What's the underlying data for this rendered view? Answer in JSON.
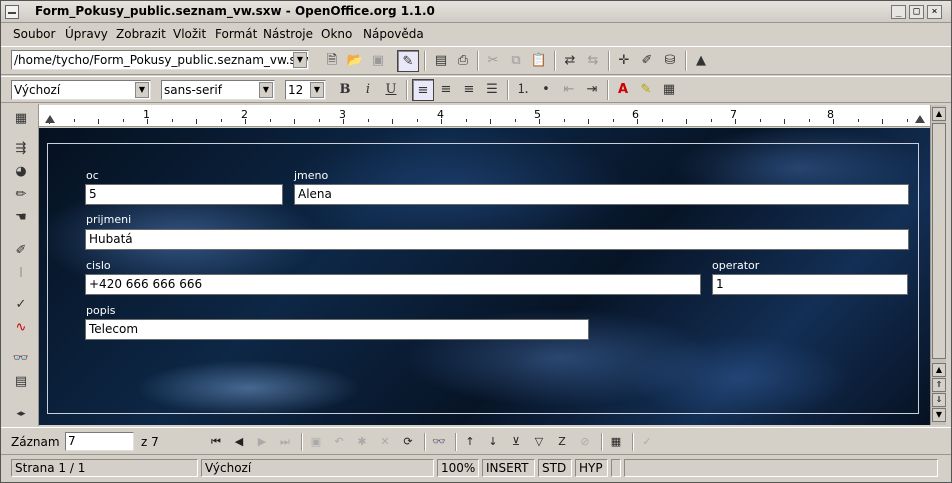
{
  "window": {
    "title": "Form_Pokusy_public.seznam_vw.sxw - OpenOffice.org 1.1.0"
  },
  "menu": [
    "Soubor",
    "Úpravy",
    "Zobrazit",
    "Vložit",
    "Formát",
    "Nástroje",
    "Okno",
    "Nápověda"
  ],
  "toolbar": {
    "url_value": "/home/tycho/Form_Pokusy_public.seznam_vw.sxw",
    "style_value": "Výchozí",
    "font_value": "sans-serif",
    "size_value": "12",
    "bold": "B",
    "italic": "i",
    "underline": "U"
  },
  "ruler": {
    "numbers": [
      "1",
      "2",
      "3",
      "4",
      "5",
      "6",
      "7",
      "8"
    ]
  },
  "form": {
    "oc": {
      "label": "oc",
      "value": "5"
    },
    "jmeno": {
      "label": "jmeno",
      "value": "Alena"
    },
    "prijmeni": {
      "label": "prijmeni",
      "value": "Hubatá"
    },
    "cislo": {
      "label": "cislo",
      "value": "+420 666 666 666"
    },
    "operator": {
      "label": "operator",
      "value": "1"
    },
    "popis": {
      "label": "popis",
      "value": "Telecom"
    }
  },
  "navigation": {
    "record_label": "Záznam",
    "record_value": "7",
    "of_label": "z 7"
  },
  "status": {
    "page": "Strana 1 / 1",
    "style": "Výchozí",
    "zoom": "100%",
    "mode": "INSERT",
    "selection": "STD",
    "hyperlink": "HYP"
  }
}
